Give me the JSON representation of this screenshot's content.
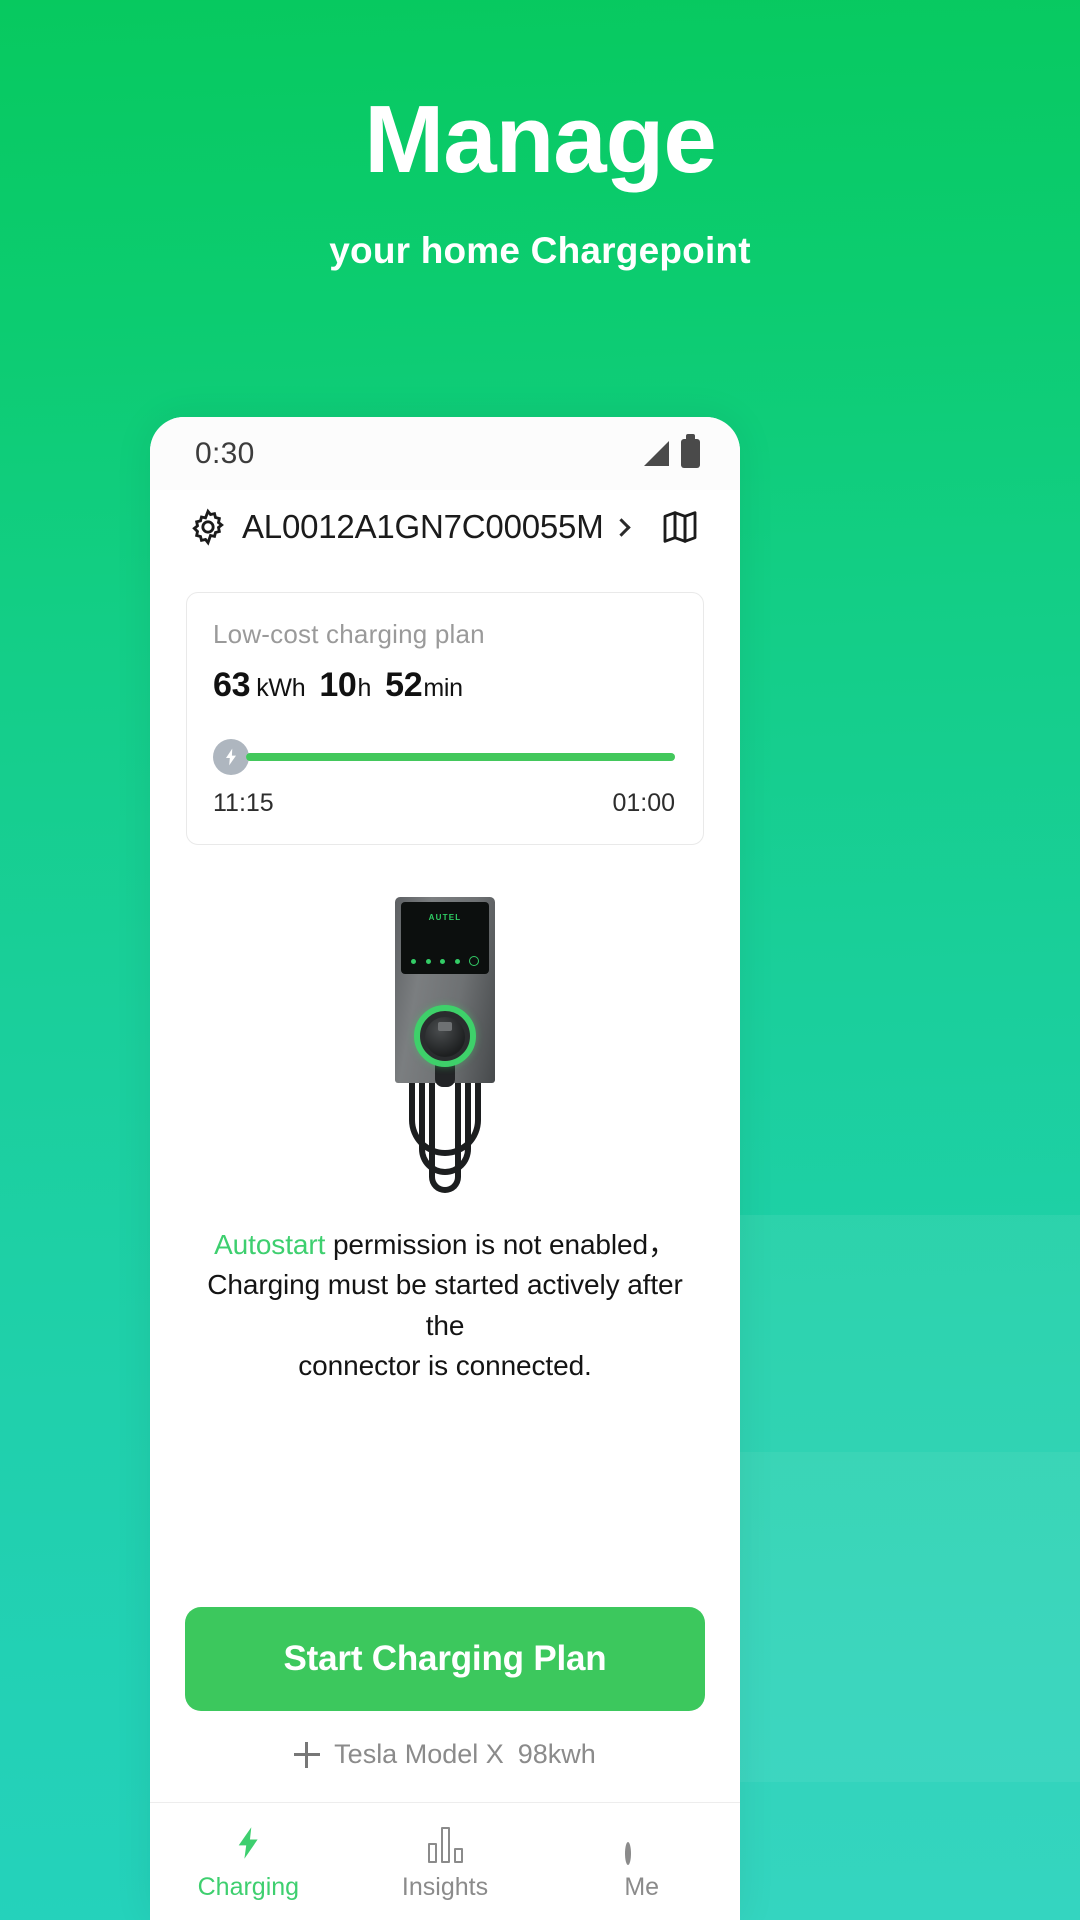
{
  "hero": {
    "title": "Manage",
    "subtitle": "your home Chargepoint"
  },
  "colors": {
    "bg_top": "#07C95F",
    "bg_bottom": "#25D2BC",
    "accent_green": "#3ECF6F",
    "button_green": "#3CC85D",
    "progress_green": "#43C85C",
    "muted_text": "#8B8B8B"
  },
  "phone": {
    "statusbar": {
      "time": "0:30",
      "signal_icon": "signal-bars-icon",
      "battery_icon": "battery-icon"
    },
    "device_header": {
      "settings_icon": "gear-icon",
      "device_id": "AL0012A1GN7C00055M",
      "chevron_icon": "chevron-right-icon",
      "map_icon": "map-icon"
    },
    "plan_card": {
      "title": "Low-cost charging plan",
      "energy_value": "63",
      "energy_unit": "kWh",
      "hours_value": "10",
      "hours_unit": "h",
      "minutes_value": "52",
      "minutes_unit": "min",
      "bolt_icon": "lightning-bolt-icon",
      "progress_percent": 100,
      "start_time": "11:15",
      "end_time": "01:00"
    },
    "charger": {
      "brand": "AUTEL",
      "image_name": "ev-wall-charger-image"
    },
    "note": {
      "highlight": "Autostart",
      "rest_line1": " permission is not enabled，",
      "line2": "Charging must be started actively after the",
      "line3": "connector is connected."
    },
    "cta": {
      "label": "Start Charging Plan"
    },
    "vehicle": {
      "add_icon": "plus-icon",
      "name": "Tesla Model X",
      "capacity": "98kwh"
    },
    "tabs": [
      {
        "label": "Charging",
        "icon": "lightning-bolt-icon",
        "active": true
      },
      {
        "label": "Insights",
        "icon": "bar-chart-icon",
        "active": false
      },
      {
        "label": "Me",
        "icon": "person-icon",
        "active": false
      }
    ]
  }
}
